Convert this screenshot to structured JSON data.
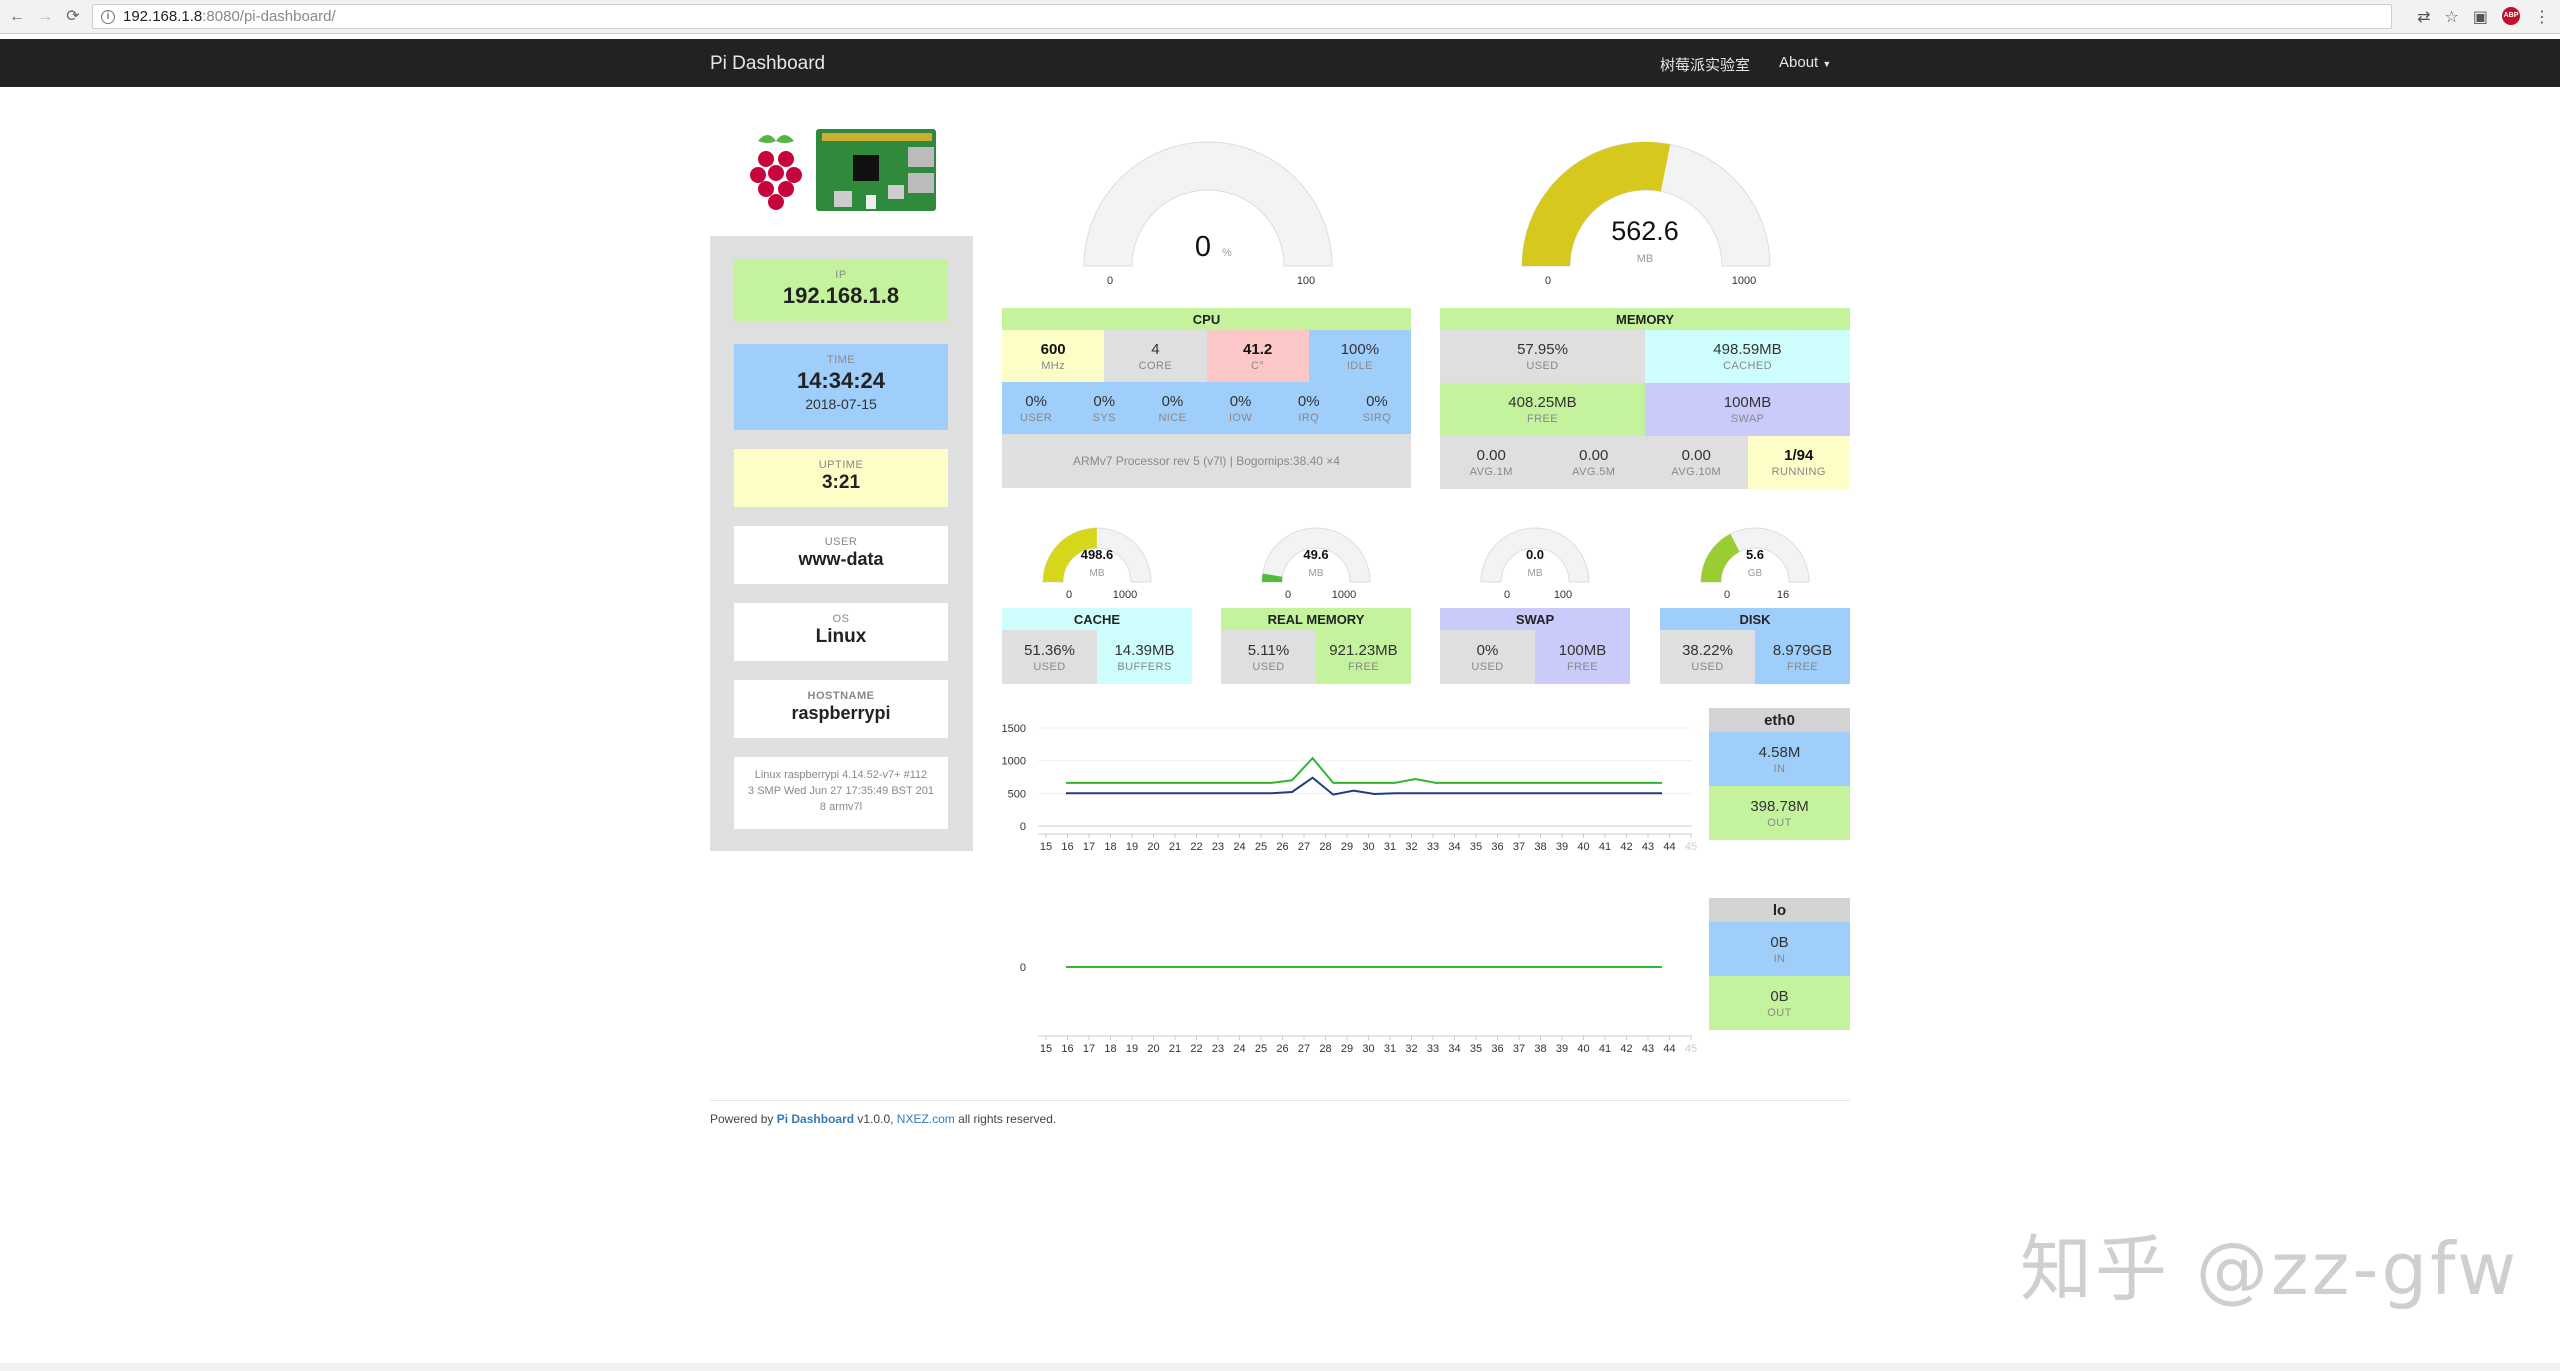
{
  "browser": {
    "url_host": "192.168.1.8",
    "url_path": ":8080/pi-dashboard/"
  },
  "navbar": {
    "brand": "Pi Dashboard",
    "link_lab": "树莓派实验室",
    "link_about": "About"
  },
  "sidebar": {
    "ip_label": "IP",
    "ip": "192.168.1.8",
    "time_label": "TIME",
    "time": "14:34:24",
    "date": "2018-07-15",
    "uptime_label": "UPTIME",
    "uptime": "3:21",
    "user_label": "USER",
    "user": "www-data",
    "os_label": "OS",
    "os": "Linux",
    "hostname_label": "HOSTNAME",
    "hostname": "raspberrypi",
    "uname": "Linux raspberrypi 4.14.52-v7+ #112\n3 SMP Wed Jun 27 17:35:49 BST 201\n8 armv7l"
  },
  "cpu_gauge": {
    "value": "0",
    "unit": "%",
    "min": "0",
    "max": "100",
    "fraction": 0
  },
  "mem_gauge": {
    "value": "562.6",
    "unit": "MB",
    "min": "0",
    "max": "1000",
    "fraction": 0.5626
  },
  "cpu": {
    "title": "CPU",
    "freq": "600",
    "freq_l": "MHz",
    "core": "4",
    "core_l": "CORE",
    "temp": "41.2",
    "temp_l": "C°",
    "idle": "100%",
    "idle_l": "IDLE",
    "user": "0%",
    "user_l": "USER",
    "sys": "0%",
    "sys_l": "SYS",
    "nice": "0%",
    "nice_l": "NICE",
    "iow": "0%",
    "iow_l": "IOW",
    "irq": "0%",
    "irq_l": "IRQ",
    "sirq": "0%",
    "sirq_l": "SIRQ",
    "model": "ARMv7 Processor rev 5 (v7l) | Bogomips:38.40 ×4"
  },
  "memory": {
    "title": "MEMORY",
    "used": "57.95%",
    "used_l": "USED",
    "cached": "498.59MB",
    "cached_l": "CACHED",
    "free": "408.25MB",
    "free_l": "FREE",
    "swap": "100MB",
    "swap_l": "SWAP",
    "avg1": "0.00",
    "avg1_l": "AVG.1M",
    "avg5": "0.00",
    "avg5_l": "AVG.5M",
    "avg10": "0.00",
    "avg10_l": "AVG.10M",
    "running": "1/94",
    "running_l": "RUNNING"
  },
  "small": [
    {
      "title": "CACHE",
      "value": "498.6",
      "unit": "MB",
      "min": "0",
      "max": "1000",
      "fraction": 0.4986,
      "color": "#d6d61c",
      "a": "51.36%",
      "a_l": "USED",
      "b": "14.39MB",
      "b_l": "BUFFERS",
      "bclass": "cyan",
      "hclass": "cyan"
    },
    {
      "title": "REAL MEMORY",
      "value": "49.6",
      "unit": "MB",
      "min": "0",
      "max": "1000",
      "fraction": 0.0496,
      "color": "#4fbd3a",
      "a": "5.11%",
      "a_l": "USED",
      "b": "921.23MB",
      "b_l": "FREE",
      "bclass": "green",
      "hclass": "green"
    },
    {
      "title": "SWAP",
      "value": "0.0",
      "unit": "MB",
      "min": "0",
      "max": "100",
      "fraction": 0,
      "color": "#999999",
      "a": "0%",
      "a_l": "USED",
      "b": "100MB",
      "b_l": "FREE",
      "bclass": "purple",
      "hclass": "purple"
    },
    {
      "title": "DISK",
      "value": "5.6",
      "unit": "GB",
      "min": "0",
      "max": "16",
      "fraction": 0.35,
      "color": "#9acd32",
      "a": "38.22%",
      "a_l": "USED",
      "b": "8.979GB",
      "b_l": "FREE",
      "bclass": "blue",
      "hclass": "blue"
    }
  ],
  "net": [
    {
      "name": "eth0",
      "in": "4.58M",
      "in_l": "IN",
      "out": "398.78M",
      "out_l": "OUT"
    },
    {
      "name": "lo",
      "in": "0B",
      "in_l": "IN",
      "out": "0B",
      "out_l": "OUT"
    }
  ],
  "chart_data": [
    {
      "type": "line",
      "x": [
        "15",
        "16",
        "17",
        "18",
        "19",
        "20",
        "21",
        "22",
        "23",
        "24",
        "25",
        "26",
        "27",
        "28",
        "29",
        "30",
        "31",
        "32",
        "33",
        "34",
        "35",
        "36",
        "37",
        "38",
        "39",
        "40",
        "41",
        "42",
        "43",
        "44",
        "45"
      ],
      "yticks": [
        "0",
        "500",
        "1000",
        "1500"
      ],
      "ylim": [
        0,
        1500
      ],
      "series": [
        {
          "color": "#2eb82e",
          "values": [
            660,
            660,
            660,
            660,
            660,
            660,
            660,
            660,
            660,
            660,
            660,
            700,
            1040,
            660,
            660,
            660,
            660,
            720,
            660,
            660,
            660,
            660,
            660,
            660,
            660,
            660,
            660,
            660,
            660,
            660
          ]
        },
        {
          "color": "#1f3a8a",
          "values": [
            500,
            500,
            500,
            500,
            500,
            500,
            500,
            500,
            500,
            500,
            500,
            520,
            740,
            480,
            540,
            490,
            500,
            500,
            500,
            500,
            500,
            500,
            500,
            500,
            500,
            500,
            500,
            500,
            500,
            500
          ]
        }
      ]
    },
    {
      "type": "line",
      "x": [
        "15",
        "16",
        "17",
        "18",
        "19",
        "20",
        "21",
        "22",
        "23",
        "24",
        "25",
        "26",
        "27",
        "28",
        "29",
        "30",
        "31",
        "32",
        "33",
        "34",
        "35",
        "36",
        "37",
        "38",
        "39",
        "40",
        "41",
        "42",
        "43",
        "44",
        "45"
      ],
      "yticks": [
        "0"
      ],
      "ylim": [
        -1,
        1
      ],
      "series": [
        {
          "color": "#2eb82e",
          "values": [
            0,
            0,
            0,
            0,
            0,
            0,
            0,
            0,
            0,
            0,
            0,
            0,
            0,
            0,
            0,
            0,
            0,
            0,
            0,
            0,
            0,
            0,
            0,
            0,
            0,
            0,
            0,
            0,
            0,
            0
          ]
        }
      ]
    }
  ],
  "footer": {
    "prefix": "Powered by",
    "pd": "Pi Dashboard",
    "ver": "v1.0.0,",
    "site": "NXEZ.com",
    "suffix": "all rights reserved."
  },
  "watermark": "知乎 @zz-gfw"
}
